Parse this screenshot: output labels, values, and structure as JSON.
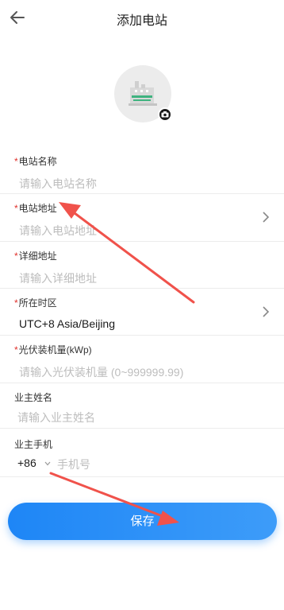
{
  "header": {
    "title": "添加电站",
    "back_icon": "arrow-left-icon"
  },
  "avatar": {
    "icon": "power-station-illustration",
    "camera_icon": "camera-icon"
  },
  "form": {
    "required_mark": "*",
    "station_name": {
      "label": "电站名称",
      "placeholder": "请输入电站名称"
    },
    "station_address": {
      "label": "电站地址",
      "placeholder": "请输入电站地址"
    },
    "detail_address": {
      "label": "详细地址",
      "placeholder": "请输入详细地址"
    },
    "timezone": {
      "label": "所在时区",
      "value": "UTC+8 Asia/Beijing"
    },
    "pv_capacity": {
      "label": "光伏装机量(kWp)",
      "placeholder": "请输入光伏装机量 (0~999999.99)"
    },
    "owner_name": {
      "label": "业主姓名",
      "placeholder": "请输入业主姓名"
    },
    "owner_phone": {
      "label": "业主手机",
      "country_code": "+86",
      "placeholder": "手机号"
    }
  },
  "save_button": {
    "label": "保存"
  },
  "colors": {
    "accent": "#1e86f6",
    "required": "#e0312b",
    "annotation_arrow": "#f0524b"
  }
}
